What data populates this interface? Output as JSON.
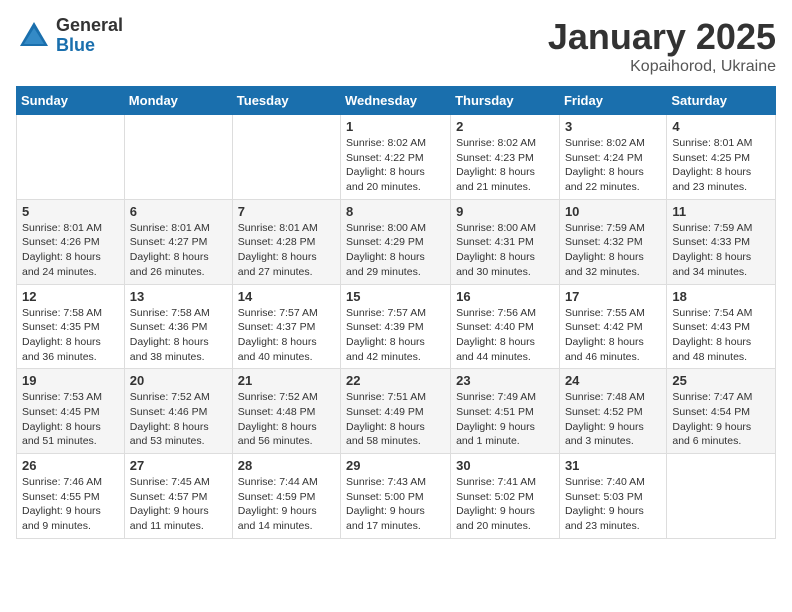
{
  "logo": {
    "general": "General",
    "blue": "Blue"
  },
  "title": "January 2025",
  "location": "Kopaihorod, Ukraine",
  "days_header": [
    "Sunday",
    "Monday",
    "Tuesday",
    "Wednesday",
    "Thursday",
    "Friday",
    "Saturday"
  ],
  "weeks": [
    [
      {
        "day": "",
        "info": ""
      },
      {
        "day": "",
        "info": ""
      },
      {
        "day": "",
        "info": ""
      },
      {
        "day": "1",
        "info": "Sunrise: 8:02 AM\nSunset: 4:22 PM\nDaylight: 8 hours\nand 20 minutes."
      },
      {
        "day": "2",
        "info": "Sunrise: 8:02 AM\nSunset: 4:23 PM\nDaylight: 8 hours\nand 21 minutes."
      },
      {
        "day": "3",
        "info": "Sunrise: 8:02 AM\nSunset: 4:24 PM\nDaylight: 8 hours\nand 22 minutes."
      },
      {
        "day": "4",
        "info": "Sunrise: 8:01 AM\nSunset: 4:25 PM\nDaylight: 8 hours\nand 23 minutes."
      }
    ],
    [
      {
        "day": "5",
        "info": "Sunrise: 8:01 AM\nSunset: 4:26 PM\nDaylight: 8 hours\nand 24 minutes."
      },
      {
        "day": "6",
        "info": "Sunrise: 8:01 AM\nSunset: 4:27 PM\nDaylight: 8 hours\nand 26 minutes."
      },
      {
        "day": "7",
        "info": "Sunrise: 8:01 AM\nSunset: 4:28 PM\nDaylight: 8 hours\nand 27 minutes."
      },
      {
        "day": "8",
        "info": "Sunrise: 8:00 AM\nSunset: 4:29 PM\nDaylight: 8 hours\nand 29 minutes."
      },
      {
        "day": "9",
        "info": "Sunrise: 8:00 AM\nSunset: 4:31 PM\nDaylight: 8 hours\nand 30 minutes."
      },
      {
        "day": "10",
        "info": "Sunrise: 7:59 AM\nSunset: 4:32 PM\nDaylight: 8 hours\nand 32 minutes."
      },
      {
        "day": "11",
        "info": "Sunrise: 7:59 AM\nSunset: 4:33 PM\nDaylight: 8 hours\nand 34 minutes."
      }
    ],
    [
      {
        "day": "12",
        "info": "Sunrise: 7:58 AM\nSunset: 4:35 PM\nDaylight: 8 hours\nand 36 minutes."
      },
      {
        "day": "13",
        "info": "Sunrise: 7:58 AM\nSunset: 4:36 PM\nDaylight: 8 hours\nand 38 minutes."
      },
      {
        "day": "14",
        "info": "Sunrise: 7:57 AM\nSunset: 4:37 PM\nDaylight: 8 hours\nand 40 minutes."
      },
      {
        "day": "15",
        "info": "Sunrise: 7:57 AM\nSunset: 4:39 PM\nDaylight: 8 hours\nand 42 minutes."
      },
      {
        "day": "16",
        "info": "Sunrise: 7:56 AM\nSunset: 4:40 PM\nDaylight: 8 hours\nand 44 minutes."
      },
      {
        "day": "17",
        "info": "Sunrise: 7:55 AM\nSunset: 4:42 PM\nDaylight: 8 hours\nand 46 minutes."
      },
      {
        "day": "18",
        "info": "Sunrise: 7:54 AM\nSunset: 4:43 PM\nDaylight: 8 hours\nand 48 minutes."
      }
    ],
    [
      {
        "day": "19",
        "info": "Sunrise: 7:53 AM\nSunset: 4:45 PM\nDaylight: 8 hours\nand 51 minutes."
      },
      {
        "day": "20",
        "info": "Sunrise: 7:52 AM\nSunset: 4:46 PM\nDaylight: 8 hours\nand 53 minutes."
      },
      {
        "day": "21",
        "info": "Sunrise: 7:52 AM\nSunset: 4:48 PM\nDaylight: 8 hours\nand 56 minutes."
      },
      {
        "day": "22",
        "info": "Sunrise: 7:51 AM\nSunset: 4:49 PM\nDaylight: 8 hours\nand 58 minutes."
      },
      {
        "day": "23",
        "info": "Sunrise: 7:49 AM\nSunset: 4:51 PM\nDaylight: 9 hours\nand 1 minute."
      },
      {
        "day": "24",
        "info": "Sunrise: 7:48 AM\nSunset: 4:52 PM\nDaylight: 9 hours\nand 3 minutes."
      },
      {
        "day": "25",
        "info": "Sunrise: 7:47 AM\nSunset: 4:54 PM\nDaylight: 9 hours\nand 6 minutes."
      }
    ],
    [
      {
        "day": "26",
        "info": "Sunrise: 7:46 AM\nSunset: 4:55 PM\nDaylight: 9 hours\nand 9 minutes."
      },
      {
        "day": "27",
        "info": "Sunrise: 7:45 AM\nSunset: 4:57 PM\nDaylight: 9 hours\nand 11 minutes."
      },
      {
        "day": "28",
        "info": "Sunrise: 7:44 AM\nSunset: 4:59 PM\nDaylight: 9 hours\nand 14 minutes."
      },
      {
        "day": "29",
        "info": "Sunrise: 7:43 AM\nSunset: 5:00 PM\nDaylight: 9 hours\nand 17 minutes."
      },
      {
        "day": "30",
        "info": "Sunrise: 7:41 AM\nSunset: 5:02 PM\nDaylight: 9 hours\nand 20 minutes."
      },
      {
        "day": "31",
        "info": "Sunrise: 7:40 AM\nSunset: 5:03 PM\nDaylight: 9 hours\nand 23 minutes."
      },
      {
        "day": "",
        "info": ""
      }
    ]
  ]
}
